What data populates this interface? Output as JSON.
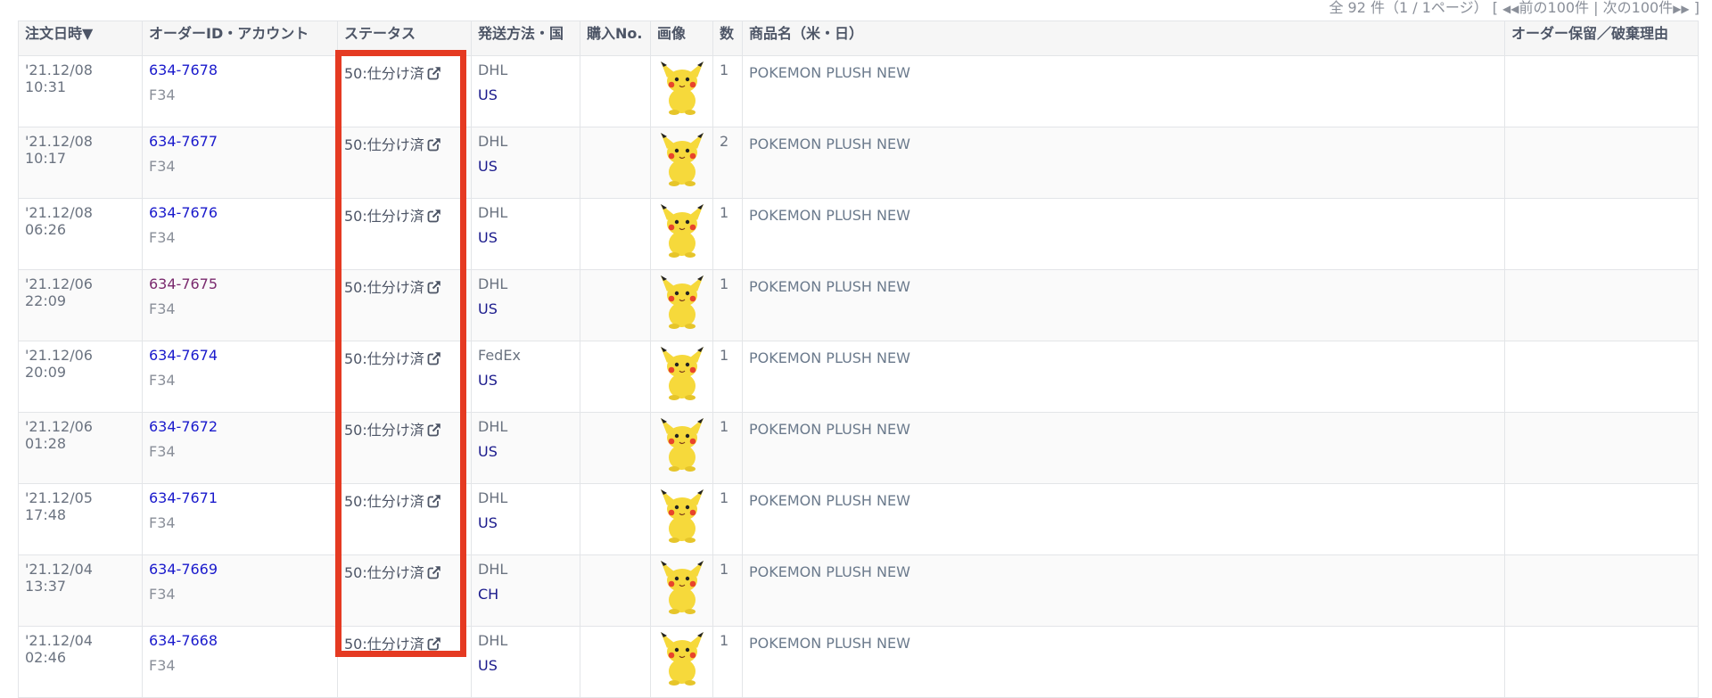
{
  "pager": {
    "total_text": "全 92 件（1 / 1ページ）",
    "bracket_open": "[",
    "prev_label": "前の100件",
    "separator": "|",
    "next_label": "次の100件",
    "bracket_close": "]"
  },
  "table": {
    "headers": [
      "注文日時▼",
      "オーダーID・アカウント",
      "ステータス",
      "発送方法・国",
      "購入No.",
      "画像",
      "数",
      "商品名（米・日）",
      "オーダー保留／破棄理由"
    ],
    "rows": [
      {
        "date": "'21.12/08 10:31",
        "order_id": "634-7678",
        "account": "F34",
        "status": "50:仕分け済",
        "ship": "DHL",
        "country": "US",
        "purchase_no": "",
        "qty": "1",
        "product": "POKEMON PLUSH NEW",
        "hold_reason": ""
      },
      {
        "date": "'21.12/08 10:17",
        "order_id": "634-7677",
        "account": "F34",
        "status": "50:仕分け済",
        "ship": "DHL",
        "country": "US",
        "purchase_no": "",
        "qty": "2",
        "product": "POKEMON PLUSH NEW",
        "hold_reason": ""
      },
      {
        "date": "'21.12/08 06:26",
        "order_id": "634-7676",
        "account": "F34",
        "status": "50:仕分け済",
        "ship": "DHL",
        "country": "US",
        "purchase_no": "",
        "qty": "1",
        "product": "POKEMON PLUSH NEW",
        "hold_reason": ""
      },
      {
        "date": "'21.12/06 22:09",
        "order_id": "634-7675",
        "account": "F34",
        "status": "50:仕分け済",
        "ship": "DHL",
        "country": "US",
        "purchase_no": "",
        "qty": "1",
        "product": "POKEMON PLUSH NEW",
        "hold_reason": ""
      },
      {
        "date": "'21.12/06 20:09",
        "order_id": "634-7674",
        "account": "F34",
        "status": "50:仕分け済",
        "ship": "FedEx",
        "country": "US",
        "purchase_no": "",
        "qty": "1",
        "product": "POKEMON PLUSH NEW",
        "hold_reason": ""
      },
      {
        "date": "'21.12/06 01:28",
        "order_id": "634-7672",
        "account": "F34",
        "status": "50:仕分け済",
        "ship": "DHL",
        "country": "US",
        "purchase_no": "",
        "qty": "1",
        "product": "POKEMON PLUSH NEW",
        "hold_reason": ""
      },
      {
        "date": "'21.12/05 17:48",
        "order_id": "634-7671",
        "account": "F34",
        "status": "50:仕分け済",
        "ship": "DHL",
        "country": "US",
        "purchase_no": "",
        "qty": "1",
        "product": "POKEMON PLUSH NEW",
        "hold_reason": ""
      },
      {
        "date": "'21.12/04 13:37",
        "order_id": "634-7669",
        "account": "F34",
        "status": "50:仕分け済",
        "ship": "DHL",
        "country": "CH",
        "purchase_no": "",
        "qty": "1",
        "product": "POKEMON PLUSH NEW",
        "hold_reason": ""
      },
      {
        "date": "'21.12/04 02:46",
        "order_id": "634-7668",
        "account": "F34",
        "status": "50:仕分け済",
        "ship": "DHL",
        "country": "US",
        "purchase_no": "",
        "qty": "1",
        "product": "POKEMON PLUSH NEW",
        "hold_reason": ""
      }
    ]
  },
  "icons": {
    "status_link": "external-link-icon",
    "product_image": "pikachu-plush-icon",
    "pager_prev": "double-triangle-left-icon",
    "pager_next": "double-triangle-right-icon"
  },
  "colors": {
    "link": "#1a1acc",
    "visited_link": "#7a2a6e",
    "country": "#1a1a8c",
    "highlight_border": "#e53a22"
  }
}
